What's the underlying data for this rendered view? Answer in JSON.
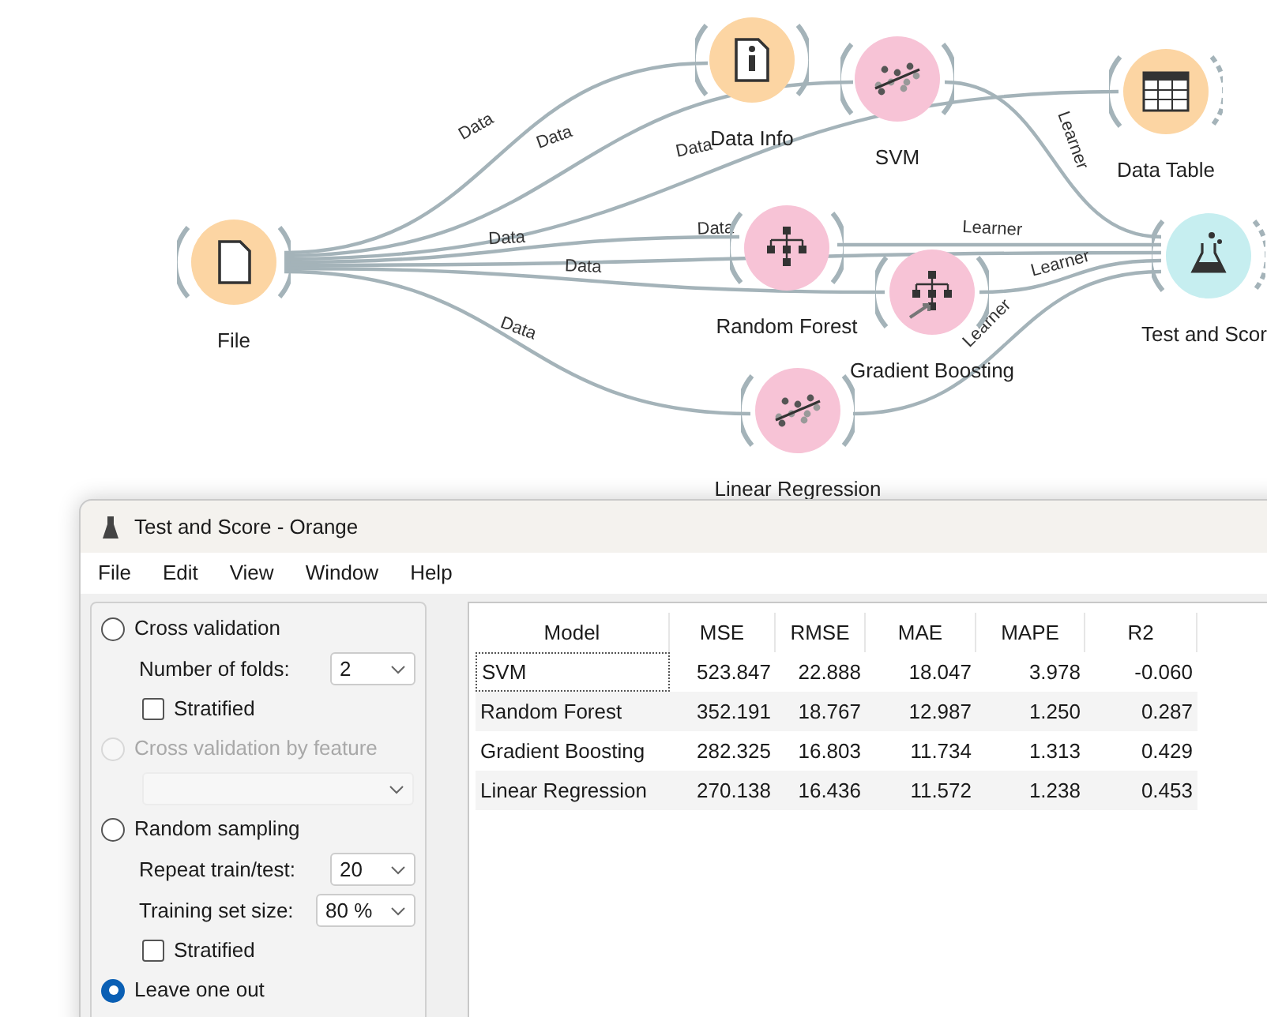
{
  "canvas": {
    "nodes": [
      {
        "label": "File",
        "kind": "data"
      },
      {
        "label": "Data Info",
        "kind": "data"
      },
      {
        "label": "SVM",
        "kind": "model"
      },
      {
        "label": "Data Table",
        "kind": "data"
      },
      {
        "label": "Random Forest",
        "kind": "model"
      },
      {
        "label": "Gradient Boosting",
        "kind": "model"
      },
      {
        "label": "Test and Scor",
        "kind": "evaluate"
      },
      {
        "label": "Linear Regression",
        "kind": "model"
      }
    ],
    "links": [
      {
        "label": "Data"
      },
      {
        "label": "Data"
      },
      {
        "label": "Data"
      },
      {
        "label": "Data"
      },
      {
        "label": "Data"
      },
      {
        "label": "Data"
      },
      {
        "label": "Data"
      },
      {
        "label": "Learner"
      },
      {
        "label": "Learner"
      },
      {
        "label": "Learner"
      },
      {
        "label": "Learner"
      }
    ]
  },
  "window": {
    "title": "Test and Score - Orange",
    "menu": [
      "File",
      "Edit",
      "View",
      "Window",
      "Help"
    ]
  },
  "settings": {
    "items": [
      {
        "kind": "radio",
        "label": "Cross validation",
        "selected": false,
        "disabled": false
      },
      {
        "kind": "combo",
        "label": "Number of folds:",
        "value": "2",
        "disabled": false
      },
      {
        "kind": "checkbox",
        "label": "Stratified",
        "checked": false
      },
      {
        "kind": "radio",
        "label": "Cross validation by feature",
        "selected": false,
        "disabled": true
      },
      {
        "kind": "combo",
        "disabled": true
      },
      {
        "kind": "radio",
        "label": "Random sampling",
        "selected": false,
        "disabled": false
      },
      {
        "kind": "combo",
        "label": "Repeat train/test:",
        "value": "20",
        "disabled": false
      },
      {
        "kind": "combo",
        "label": "Training set size:",
        "value": "80 %",
        "disabled": false
      },
      {
        "kind": "checkbox",
        "label": "Stratified",
        "checked": false
      },
      {
        "kind": "radio",
        "label": "Leave one out",
        "selected": true,
        "disabled": false
      }
    ]
  },
  "table": {
    "columns": [
      "Model",
      "MSE",
      "RMSE",
      "MAE",
      "MAPE",
      "R2"
    ],
    "rows": [
      {
        "cells": [
          "SVM",
          "523.847",
          "22.888",
          "18.047",
          "3.978",
          "-0.060"
        ],
        "focused": true
      },
      {
        "cells": [
          "Random Forest",
          "352.191",
          "18.767",
          "12.987",
          "1.250",
          "0.287"
        ],
        "focused": false
      },
      {
        "cells": [
          "Gradient Boosting",
          "282.325",
          "16.803",
          "11.734",
          "1.313",
          "0.429"
        ],
        "focused": false
      },
      {
        "cells": [
          "Linear Regression",
          "270.138",
          "16.436",
          "11.572",
          "1.238",
          "0.453"
        ],
        "focused": false
      }
    ]
  }
}
